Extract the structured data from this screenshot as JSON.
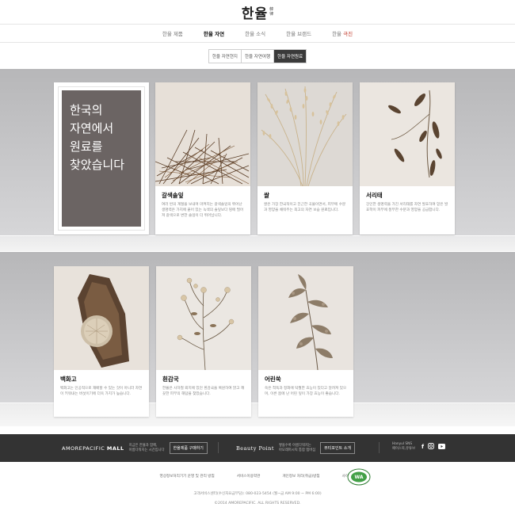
{
  "header": {
    "logo_main": "한율",
    "logo_sub_1": "韓",
    "logo_sub_2": "律"
  },
  "gnb": [
    {
      "label": "한율 제품",
      "accent": ""
    },
    {
      "label": "한율 자연",
      "accent": ""
    },
    {
      "label": "한율 소식",
      "accent": ""
    },
    {
      "label": "한율 브랜드",
      "accent": ""
    },
    {
      "label": "한율 ",
      "accent": "극진"
    }
  ],
  "subnav": [
    "한율 자연현지",
    "한율 자연여행",
    "한율 자연원료"
  ],
  "intro": {
    "line1": "한국의",
    "line2": "자연에서",
    "line3": "원료를",
    "line4": "찾았습니다"
  },
  "cards": [
    {
      "name": "갈색솔잎",
      "desc": "여러 번의 계절을 보내며 마켜지는 갈색솔잎의 뛰어난 생명력은 가지에 붙어 있는 녹색의 솔잎보다 땅에 떨어져 갈색으로 변한 솔잎이 더 뛰어납니다."
    },
    {
      "name": "쌀",
      "desc": "쌀은 가장 한국적이고 친근한 곡물이면서, 피부에 수분과 영양을 채워주는 최고의 자연 보습 원료입니다."
    },
    {
      "name": "서리태",
      "desc": "강인한 생명력을 가진 서리태를 자연 발효하여 얻은 발효학이 피부에 풍부한 수분과 영양을 공급합니다."
    },
    {
      "name": "백화고",
      "desc": "백화고는 인공적으로 재배할 수 있는 것이 아니라 자연이 키워내는 버섯이기에 더욱 가치가 높습니다."
    },
    {
      "name": "흰감국",
      "desc": "한율은 사하철 뫼지에 있던 흰감국을 복원하여 맑고 깨끗한 피부의 해답을 찾았습니다."
    },
    {
      "name": "어린쑥",
      "desc": "쑥은 척독과 정화에 탁월한 효능이 있다고 알려져 있으며, 이른 봄에 난 어린 잎이 가장 효능이 좋습니다."
    }
  ],
  "footer": {
    "mall_logo_1": "AMOREPACIFIC ",
    "mall_logo_2": "MALL",
    "mall_desc_1": "지금은 한율과 함께,",
    "mall_desc_2": "아름다워지는 시간입니다",
    "mall_btn": "한율제품 구매하기",
    "bp_logo": "Beauty Point",
    "bp_desc_1": "쌓을수록 아름다워지는",
    "bp_desc_2": "아모레퍼시픽 통합 멤버십",
    "bp_btn": "뷰티포인트 소개",
    "sns_1": "Hanyul SNS",
    "sns_2": "페이스북,유튜브",
    "sns_icons": [
      "facebook-icon",
      "instagram-icon",
      "youtube-icon"
    ],
    "links": [
      "영상정보처리기기 운영 및 관리 방침",
      "서비스이용약관",
      "개인정보 처리(취급)방침",
      "사이트맵"
    ],
    "cs": "고객서비스센터(수신자요금부담): 080-023-5454 (월~금 AM 9:00 ~ PM 6:00)",
    "copyright": "©2014 AMOREPACIFIC. ALL RIGHTS RESERVED."
  }
}
